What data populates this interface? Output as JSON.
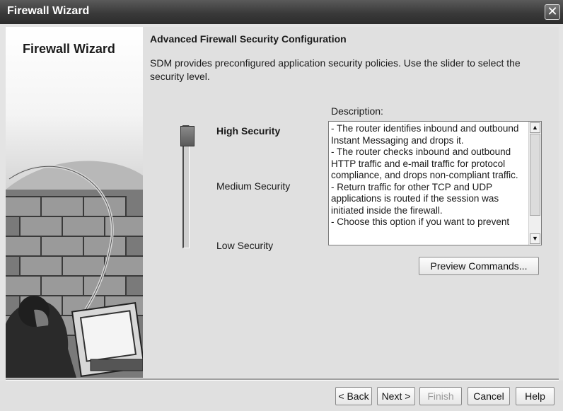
{
  "window": {
    "title": "Firewall Wizard",
    "close_glyph": "✕"
  },
  "sidebar": {
    "title": "Firewall Wizard"
  },
  "content": {
    "heading": "Advanced Firewall Security Configuration",
    "intro": "SDM provides preconfigured application security policies. Use the slider to select the security level.",
    "levels": {
      "high": "High Security",
      "medium": "Medium Security",
      "low": "Low Security"
    },
    "selected_level": "High Security",
    "description_label": "Description:",
    "description_text": "- The router identifies inbound and outbound Instant Messaging and drops it.\n- The router checks inbound and outbound HTTP traffic and e-mail traffic for protocol compliance, and drops non-compliant traffic.\n- Return traffic for other TCP and UDP applications is routed if the session was initiated inside the firewall.\n- Choose this option if you want to prevent",
    "preview_button": "Preview Commands..."
  },
  "footer": {
    "back": "< Back",
    "next": "Next >",
    "finish": "Finish",
    "cancel": "Cancel",
    "help": "Help"
  },
  "icons": {
    "scroll_up": "scroll-up-arrow-icon",
    "scroll_down": "scroll-down-arrow-icon",
    "close": "close-icon"
  }
}
